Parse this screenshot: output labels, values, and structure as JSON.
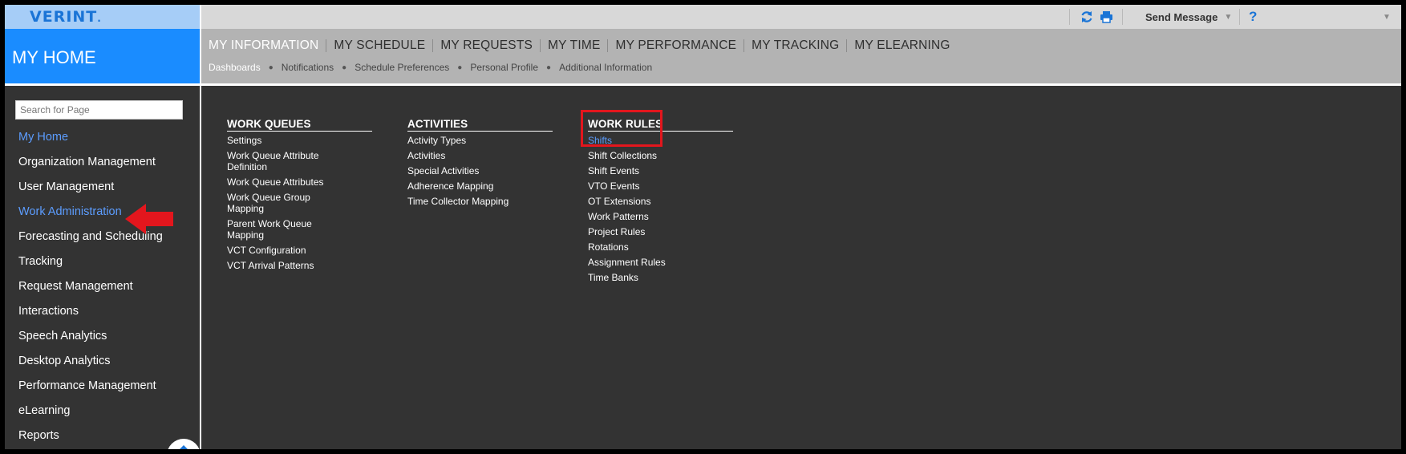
{
  "app": {
    "logo": "VERINT",
    "section_title": "MY HOME"
  },
  "utility_bar": {
    "send_message": "Send Message",
    "help": "?"
  },
  "nav": {
    "tabs": [
      "MY INFORMATION",
      "MY SCHEDULE",
      "MY REQUESTS",
      "MY TIME",
      "MY PERFORMANCE",
      "MY TRACKING",
      "MY ELEARNING"
    ],
    "subtabs": [
      "Dashboards",
      "Notifications",
      "Schedule Preferences",
      "Personal Profile",
      "Additional Information"
    ]
  },
  "sidebar": {
    "search_placeholder": "Search for Page",
    "items": [
      "My Home",
      "Organization Management",
      "User Management",
      "Work Administration",
      "Forecasting and Scheduling",
      "Tracking",
      "Request Management",
      "Interactions",
      "Speech Analytics",
      "Desktop Analytics",
      "Performance Management",
      "eLearning",
      "Reports"
    ]
  },
  "columns": [
    {
      "title": "WORK QUEUES",
      "items": [
        "Settings",
        "Work Queue Attribute Definition",
        "Work Queue Attributes",
        "Work Queue Group Mapping",
        "Parent Work Queue Mapping",
        "VCT Configuration",
        "VCT Arrival Patterns"
      ]
    },
    {
      "title": "ACTIVITIES",
      "items": [
        "Activity Types",
        "Activities",
        "Special Activities",
        "Adherence Mapping",
        "Time Collector Mapping"
      ]
    },
    {
      "title": "WORK RULES",
      "items": [
        "Shifts",
        "Shift Collections",
        "Shift Events",
        "VTO Events",
        "OT Extensions",
        "Work Patterns",
        "Project Rules",
        "Rotations",
        "Assignment Rules",
        "Time Banks"
      ]
    }
  ],
  "colors": {
    "accent_blue": "#1a8cff",
    "link_blue": "#5c9dff",
    "highlight_red": "#e3161d",
    "background": "#333333"
  }
}
